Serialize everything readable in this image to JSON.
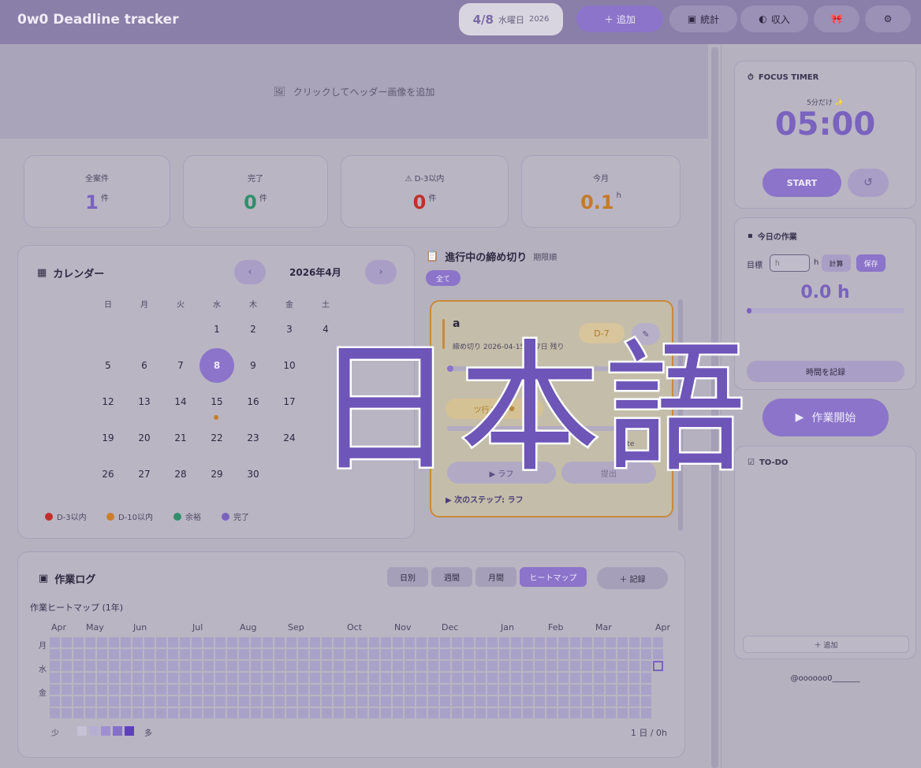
{
  "header": {
    "title": "0w0 Deadline tracker",
    "date": {
      "day": "4/8",
      "weekday": "水曜日",
      "year": "2026"
    },
    "buttons": {
      "add": "＋ 追加",
      "stats": "統計",
      "income": "収入",
      "ribbon": "🎀",
      "settings": "⚙"
    }
  },
  "banner": {
    "text": "クリックしてヘッダー画像を追加"
  },
  "stats": [
    {
      "label": "全案件",
      "value": "1",
      "unit": "件",
      "color": "#7a62bf"
    },
    {
      "label": "完了",
      "value": "0",
      "unit": "件",
      "color": "#2f8f6b"
    },
    {
      "label": "D-3以内",
      "value": "0",
      "unit": "件",
      "color": "#c0302a"
    },
    {
      "label": "今月",
      "value": "0.1",
      "unit": "h",
      "color": "#c57a2a"
    }
  ],
  "calendar": {
    "title": "カレンダー",
    "month": "2026年4月",
    "prev": "‹",
    "next": "›",
    "weekdays": [
      "日",
      "月",
      "火",
      "水",
      "木",
      "金",
      "土"
    ],
    "days": [
      "1",
      "2",
      "3",
      "4",
      "5",
      "6",
      "7",
      "8",
      "9",
      "10",
      "12",
      "13",
      "14",
      "15",
      "16",
      "17",
      "19",
      "20",
      "21",
      "22",
      "23",
      "24",
      "26",
      "27",
      "28",
      "29",
      "30"
    ],
    "today": "8",
    "legend": [
      {
        "label": "D-3以内",
        "color": "#c0302a"
      },
      {
        "label": "D-10以内",
        "color": "#c97f2a"
      },
      {
        "label": "余裕",
        "color": "#2f8f6b"
      },
      {
        "label": "完了",
        "color": "#7a62bf"
      }
    ]
  },
  "deadlines": {
    "title": "進行中の締め切り",
    "sort": "期限順",
    "filter": "全て",
    "card": {
      "name": "a",
      "badge": "D-7",
      "due": "締め切り 2026-04-15 ・ 7日 残り",
      "partial_right": "7日 0",
      "tag": "ツ行こう",
      "steps_partial": "/5 ste",
      "btn_rough": "▶ ラフ",
      "btn_submit": "提出",
      "next_step": "▶ 次のステップ: ラフ"
    }
  },
  "worklog": {
    "title": "作業ログ",
    "tabs": [
      "日別",
      "週間",
      "月間",
      "ヒートマップ"
    ],
    "record": "＋ 記録",
    "subtitle": "作業ヒートマップ (1年)",
    "months": [
      "Apr",
      "May",
      "Jun",
      "Jul",
      "Aug",
      "Sep",
      "Oct",
      "Nov",
      "Dec",
      "Jan",
      "Feb",
      "Mar",
      "Apr"
    ],
    "day_labels": [
      "月",
      "水",
      "金"
    ],
    "legend_low": "少",
    "legend_high": "多",
    "summary": "1 日 / 0h"
  },
  "focus": {
    "title": "FOCUS TIMER",
    "subtitle": "5分だけ ✨",
    "time": "05:00",
    "start": "START",
    "reset": "↺"
  },
  "today_work": {
    "title": "今日の作業",
    "goal_label": "目標",
    "placeholder": "h",
    "unit": "h",
    "calc": "計算",
    "save": "保存",
    "value": "0.0 h",
    "record": "時間を記録"
  },
  "start_work": "作業開始",
  "todo": {
    "title": "TO-DO",
    "add": "＋ 追加"
  },
  "footer": {
    "handle": "@oooooo0_______"
  },
  "overlay_text": "日本語"
}
